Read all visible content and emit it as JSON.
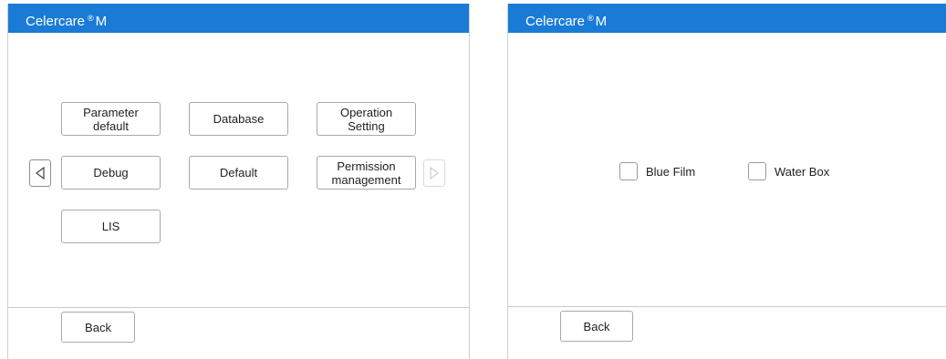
{
  "theme": {
    "accent": "#1a7bd6"
  },
  "left": {
    "title": "Celercare",
    "title_mark": "®",
    "title_suffix": "M",
    "menu": [
      {
        "label": "Parameter\ndefault"
      },
      {
        "label": "Database"
      },
      {
        "label": "Operation\nSetting"
      },
      {
        "label": "Debug"
      },
      {
        "label": "Default"
      },
      {
        "label": "Permission\nmanagement"
      },
      {
        "label": "LIS"
      }
    ],
    "prev_icon": "triangle-left-icon",
    "next_icon": "triangle-right-icon",
    "back_label": "Back"
  },
  "right": {
    "title": "Celercare",
    "title_mark": "®",
    "title_suffix": "M",
    "options": [
      {
        "label": "Blue Film",
        "checked": false
      },
      {
        "label": "Water Box",
        "checked": false
      }
    ],
    "back_label": "Back"
  }
}
